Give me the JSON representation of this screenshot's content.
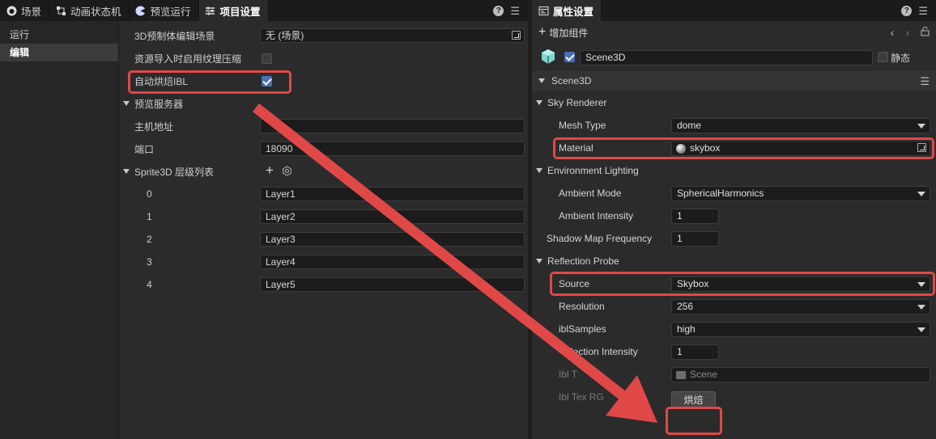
{
  "left_tabs": [
    {
      "label": "场景",
      "icon": "scene-icon"
    },
    {
      "label": "动画状态机",
      "icon": "state-machine-icon"
    },
    {
      "label": "预览运行",
      "icon": "preview-icon"
    },
    {
      "label": "项目设置",
      "icon": "settings-icon"
    }
  ],
  "right_tabs": [
    {
      "label": "属性设置",
      "icon": "properties-icon"
    }
  ],
  "sidebar": {
    "items": [
      {
        "label": "运行"
      },
      {
        "label": "编辑"
      }
    ]
  },
  "settings": {
    "prefab_scene": {
      "label": "3D预制体编辑场景",
      "value": "无 (场景)"
    },
    "texture_compress": {
      "label": "资源导入时启用纹理压缩"
    },
    "auto_bake_ibl": {
      "label": "自动烘焙IBL"
    },
    "preview_server": {
      "label": "预览服务器"
    },
    "host": {
      "label": "主机地址",
      "value": ""
    },
    "port": {
      "label": "端口",
      "value": "18090"
    },
    "layers": {
      "label": "Sprite3D 层级列表",
      "items": [
        {
          "index": "0",
          "value": "Layer1"
        },
        {
          "index": "1",
          "value": "Layer2"
        },
        {
          "index": "2",
          "value": "Layer3"
        },
        {
          "index": "3",
          "value": "Layer4"
        },
        {
          "index": "4",
          "value": "Layer5"
        }
      ]
    }
  },
  "inspector": {
    "add_component": "增加组件",
    "node_name": "Scene3D",
    "static_label": "静态",
    "section_title": "Scene3D",
    "sky_renderer": "Sky Renderer",
    "mesh_type": {
      "label": "Mesh Type",
      "value": "dome"
    },
    "material": {
      "label": "Material",
      "value": "skybox"
    },
    "env_lighting": "Environment Lighting",
    "ambient_mode": {
      "label": "Ambient Mode",
      "value": "SphericalHarmonics"
    },
    "ambient_intensity": {
      "label": "Ambient Intensity",
      "value": "1"
    },
    "shadow_map_frequency": {
      "label": "Shadow Map Frequency",
      "value": "1"
    },
    "reflection_probe": "Reflection Probe",
    "source": {
      "label": "Source",
      "value": "Skybox"
    },
    "resolution": {
      "label": "Resolution",
      "value": "256"
    },
    "ibl_samples": {
      "label": "iblSamples",
      "value": "high"
    },
    "reflection_intensity": {
      "label": "eflection Intensity",
      "value": "1"
    },
    "ibl_tex": {
      "label": "Ibl T",
      "value": "Scene"
    },
    "ibl_tex_rgbd": {
      "label": "Ibl Tex RG"
    },
    "bake_button": "烘焙"
  },
  "colors": {
    "highlight": "#e04848",
    "checkbox_on": "#4a6fb5"
  }
}
